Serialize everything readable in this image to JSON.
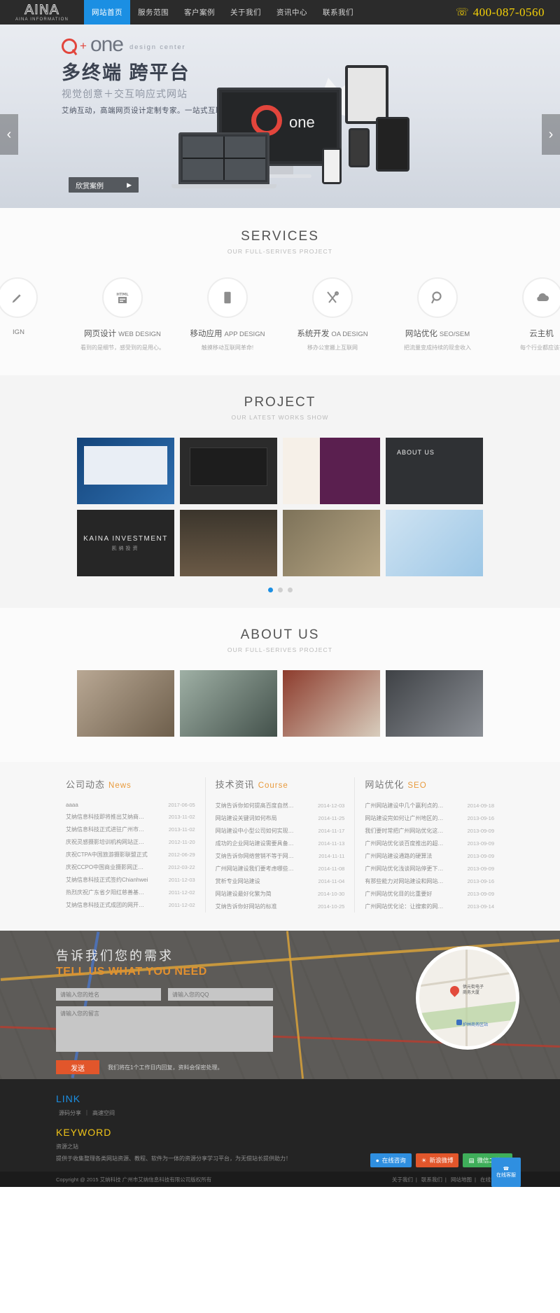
{
  "header": {
    "logo": {
      "mark": "AINA",
      "sub": "AINA INFORMATION"
    },
    "nav": [
      {
        "label": "网站首页",
        "active": true
      },
      {
        "label": "服务范围",
        "active": false
      },
      {
        "label": "客户案例",
        "active": false
      },
      {
        "label": "关于我们",
        "active": false
      },
      {
        "label": "资讯中心",
        "active": false
      },
      {
        "label": "联系我们",
        "active": false
      }
    ],
    "phone": "400-087-0560",
    "phone_icon": "phone-icon"
  },
  "banner": {
    "brand_plus": "+",
    "brand_one": "one",
    "brand_dc": "design center",
    "title": "多终端 跨平台",
    "subtitle": "视觉创意＋交互响应式网站",
    "desc": "艾纳互动，高端网页设计定制专家。一站式互联网服务商",
    "button": "欣赏案例",
    "button_arrow": "▶",
    "prev_arrow": "‹",
    "next_arrow": "›",
    "screen_one": "one"
  },
  "services": {
    "title": "SERVICES",
    "subtitle": "OUR FULL-SERIVES PROJECT",
    "items": [
      {
        "name": "",
        "en": "IGN",
        "desc": "",
        "icon": "design-icon"
      },
      {
        "name": "网页设计",
        "en": "WEB DESIGN",
        "desc": "看到的是细节，感受到的是用心。",
        "icon": "html5-icon"
      },
      {
        "name": "移动应用",
        "en": "APP DESIGN",
        "desc": "触摸移动互联网革命!",
        "icon": "mobile-icon"
      },
      {
        "name": "系统开发",
        "en": "OA DESIGN",
        "desc": "移办公室搬上互联网",
        "icon": "tools-icon"
      },
      {
        "name": "网站优化",
        "en": "SEO/SEM",
        "desc": "把流量变成持续的现金收入",
        "icon": "search-icon"
      },
      {
        "name": "云主机",
        "en": "",
        "desc": "每个行业都应该有",
        "icon": "cloud-icon"
      }
    ]
  },
  "project": {
    "title": "PROJECT",
    "subtitle": "OUR LATEST WORKS SHOW",
    "cards": [
      {
        "label": "",
        "art": "c1"
      },
      {
        "label": "",
        "art": "c2"
      },
      {
        "label": "",
        "art": "c3"
      },
      {
        "label": "",
        "art": "c4"
      },
      {
        "label": "KAINA INVESTMENT",
        "sublabel": "凯纳投资",
        "art": "c5"
      },
      {
        "label": "",
        "art": "c6"
      },
      {
        "label": "",
        "art": "c7"
      },
      {
        "label": "",
        "art": "c8"
      }
    ],
    "dots": [
      "1",
      "2",
      "3"
    ],
    "active_dot": 0
  },
  "about": {
    "title": "ABOUT US",
    "subtitle": "OUR FULL-SERIVES PROJECT",
    "cards": [
      {
        "art": "a1"
      },
      {
        "art": "a2"
      },
      {
        "art": "a3"
      },
      {
        "art": "a4"
      }
    ]
  },
  "news": {
    "columns": [
      {
        "title": "公司动态",
        "tag": "News",
        "items": [
          {
            "text": "aaaa",
            "date": "2017-06-05"
          },
          {
            "text": "艾纳信息科技即将推出艾纳商务通",
            "date": "2013-11-02"
          },
          {
            "text": "艾纳信息科技正式进驻广州市番禺",
            "date": "2013-11-02"
          },
          {
            "text": "庆祝灵感摄影培训机构网站正式运",
            "date": "2012-11-20"
          },
          {
            "text": "庆祝CTPA中国旅游摄影联盟正式",
            "date": "2012-06-29"
          },
          {
            "text": "庆祝CCPO中国商业摄影网正式上",
            "date": "2012-03-22"
          },
          {
            "text": "艾纳信息科技正式签约Chianhwei",
            "date": "2011-12-03"
          },
          {
            "text": "热烈庆祝广东省夕阳红慈善基金会",
            "date": "2011-12-02"
          },
          {
            "text": "艾纳信息科技正式成团的网开白鹭网",
            "date": "2011-12-02"
          }
        ]
      },
      {
        "title": "技术资讯",
        "tag": "Course",
        "items": [
          {
            "text": "艾纳告诉你如何提高百度自然排名",
            "date": "2014-12-03"
          },
          {
            "text": "网站建设关键词如何布局",
            "date": "2014-11-25"
          },
          {
            "text": "网站建设中小型公司如何实现网络",
            "date": "2014-11-17"
          },
          {
            "text": "成功的企业网站建设需要具备哪些",
            "date": "2014-11-13"
          },
          {
            "text": "艾纳告诉你网络营销不等于网站建",
            "date": "2014-11-11"
          },
          {
            "text": "广州网站建设我们要考虑哪些因素",
            "date": "2014-11-08"
          },
          {
            "text": "赏析专业网站建设",
            "date": "2014-11-04"
          },
          {
            "text": "网站建设最好化繁为简",
            "date": "2014-10-30"
          },
          {
            "text": "艾纳告诉你好网站的标准",
            "date": "2014-10-25"
          }
        ]
      },
      {
        "title": "网站优化",
        "tag": "SEO",
        "items": [
          {
            "text": "广州网站建设中几个赢利点的分享",
            "date": "2014-09-18"
          },
          {
            "text": "网站建设完如何让广州地区的人知",
            "date": "2013-09-16"
          },
          {
            "text": "我们要时常把广州网站优化这几种",
            "date": "2013-09-09"
          },
          {
            "text": "广州网站优化谈百度推出的超绝外",
            "date": "2013-09-09"
          },
          {
            "text": "广州网站建设通路的硬算法",
            "date": "2013-09-09"
          },
          {
            "text": "广州网站优化浅谈网站停更下导分",
            "date": "2013-09-09"
          },
          {
            "text": "有那些能力对网站建设和网站优化",
            "date": "2013-09-16"
          },
          {
            "text": "广州网站优化目的比重要好",
            "date": "2013-09-09"
          },
          {
            "text": "广州网站优化论：让搜索的网站错",
            "date": "2013-09-14"
          }
        ]
      }
    ]
  },
  "contact": {
    "title_cn": "告诉我们您的需求",
    "title_en": "TELL US WHAT YOU NEED",
    "name_placeholder": "请输入您的姓名",
    "qq_placeholder": "请输入您的QQ",
    "message_placeholder": "请输入您的留言",
    "send_label": "发送",
    "note": "我们将在1个工作日内回复，资料会保密处理。",
    "map": {
      "pin_label": "供元街电子\n商务大厦",
      "station_label": "护林商务区站"
    }
  },
  "footer": {
    "link_heading": "LINK",
    "links": [
      "源码分享",
      "高速空间"
    ],
    "keyword_heading": "KEYWORD",
    "keyword_text": "资源之站",
    "desc": "提供于收集整理各类网站资源、教程、软件为一体的资源分享学习平台，为无偿站长提供助力！",
    "chat_buttons": [
      {
        "label": "在线咨询",
        "icon": "chat-icon",
        "color": "#2f8fe0"
      },
      {
        "label": "新浪微博",
        "icon": "weibo-icon",
        "color": "#e2562b"
      },
      {
        "label": "微信二维码",
        "icon": "wechat-icon",
        "color": "#3fae5a"
      }
    ],
    "qr_float": "在线客服",
    "copyright": "Copyright @ 2015 艾纳科技 广州市艾纳信息科技有限公司版权所有",
    "bottom_links": [
      "关于我们",
      "联系我们",
      "网站地图",
      "在线留言"
    ]
  },
  "colors": {
    "accent_blue": "#1b8fe3",
    "accent_yellow": "#f5d107",
    "accent_orange": "#e2562b",
    "dark": "#2b2b2b"
  }
}
